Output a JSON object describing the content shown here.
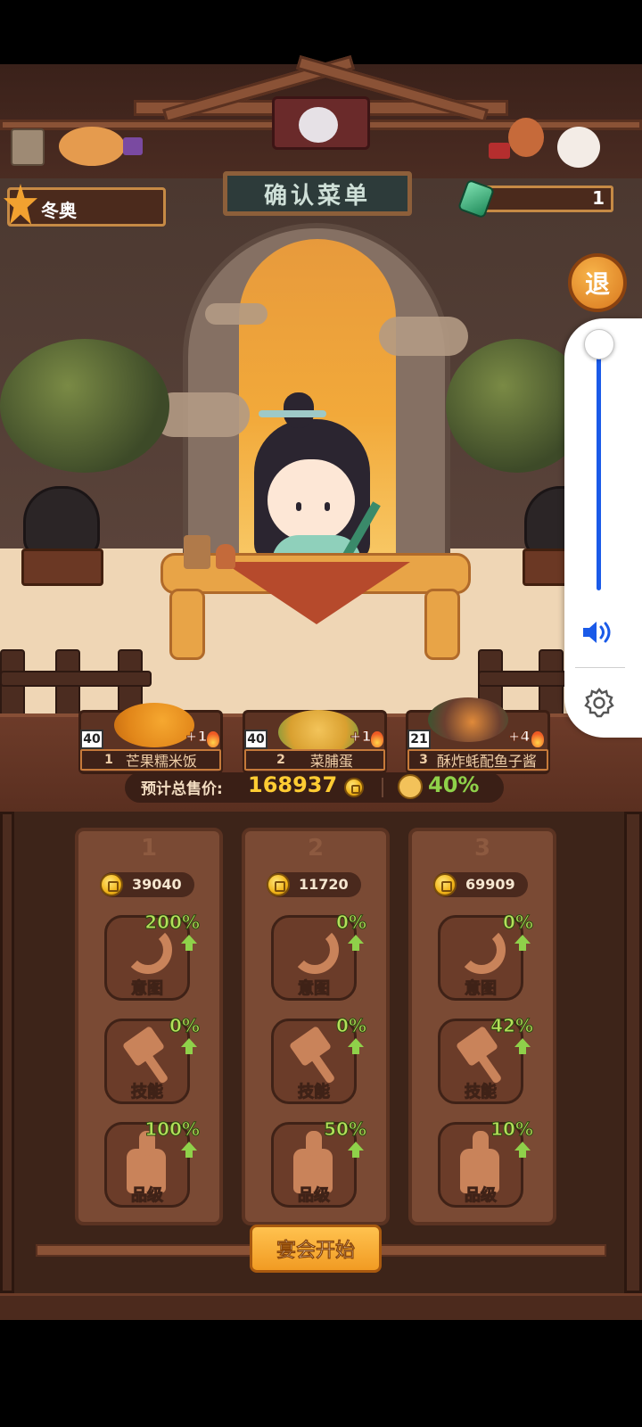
{
  "header": {
    "player_name": "冬奥",
    "gem_count": "1",
    "sign_title": "确认菜单",
    "exit_label": "退"
  },
  "dishes": [
    {
      "index": "1",
      "name": "芒果糯米饭",
      "quantity": "40",
      "bonus": "+1"
    },
    {
      "index": "2",
      "name": "菜脯蛋",
      "quantity": "40",
      "bonus": "+1"
    },
    {
      "index": "3",
      "name": "酥炸蚝配鱼子酱",
      "quantity": "21",
      "bonus": "+4"
    }
  ],
  "summary": {
    "price_label": "预计总售价:",
    "total_price": "168937",
    "rate": "40%"
  },
  "columns": [
    {
      "number": "1",
      "price": "39040",
      "slots": [
        {
          "label": "意图",
          "percent": "200%"
        },
        {
          "label": "技能",
          "percent": "0%"
        },
        {
          "label": "品级",
          "percent": "100%"
        }
      ]
    },
    {
      "number": "2",
      "price": "11720",
      "slots": [
        {
          "label": "意图",
          "percent": "0%"
        },
        {
          "label": "技能",
          "percent": "0%"
        },
        {
          "label": "品级",
          "percent": "50%"
        }
      ]
    },
    {
      "number": "3",
      "price": "69909",
      "slots": [
        {
          "label": "意图",
          "percent": "0%"
        },
        {
          "label": "技能",
          "percent": "42%"
        },
        {
          "label": "品级",
          "percent": "10%"
        }
      ]
    }
  ],
  "start_button": "宴会开始",
  "volume": {
    "level": 1.0
  },
  "colors": {
    "accent_gold": "#ffcc33",
    "accent_green": "#8fd14a",
    "volume_blue": "#1a5ae8"
  },
  "icons": [
    "ladle-icon",
    "spatula-icon",
    "thumbs-up-icon",
    "coin-icon",
    "gem-icon",
    "speaker-icon",
    "gear-icon",
    "fire-icon"
  ]
}
